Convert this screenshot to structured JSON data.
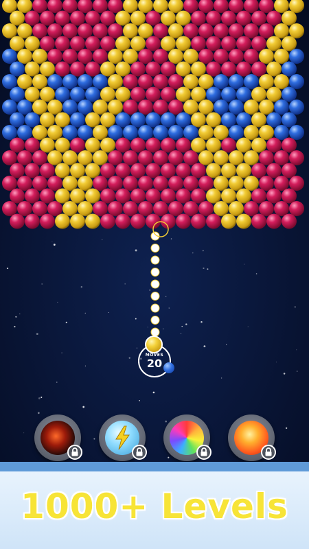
{
  "hud": {
    "moves_label": "MOVES",
    "moves_count": "20"
  },
  "boosters": [
    {
      "name": "Bomb",
      "icon": "bomb-icon",
      "locked": true
    },
    {
      "name": "Lightning",
      "icon": "lightning-icon",
      "locked": true
    },
    {
      "name": "Rainbow",
      "icon": "rainbow-ball-icon",
      "locked": true
    },
    {
      "name": "Fire",
      "icon": "fire-ball-icon",
      "locked": true
    }
  ],
  "banner": {
    "text": "1000+ Levels"
  },
  "colors": {
    "gold": "#f2cc35",
    "blue": "#2f6de0",
    "pink": "#d41d5c",
    "background": "#06102a",
    "banner_text": "#f7e437"
  },
  "shooter": {
    "current_ball": "gold",
    "next_ball": "blue"
  }
}
